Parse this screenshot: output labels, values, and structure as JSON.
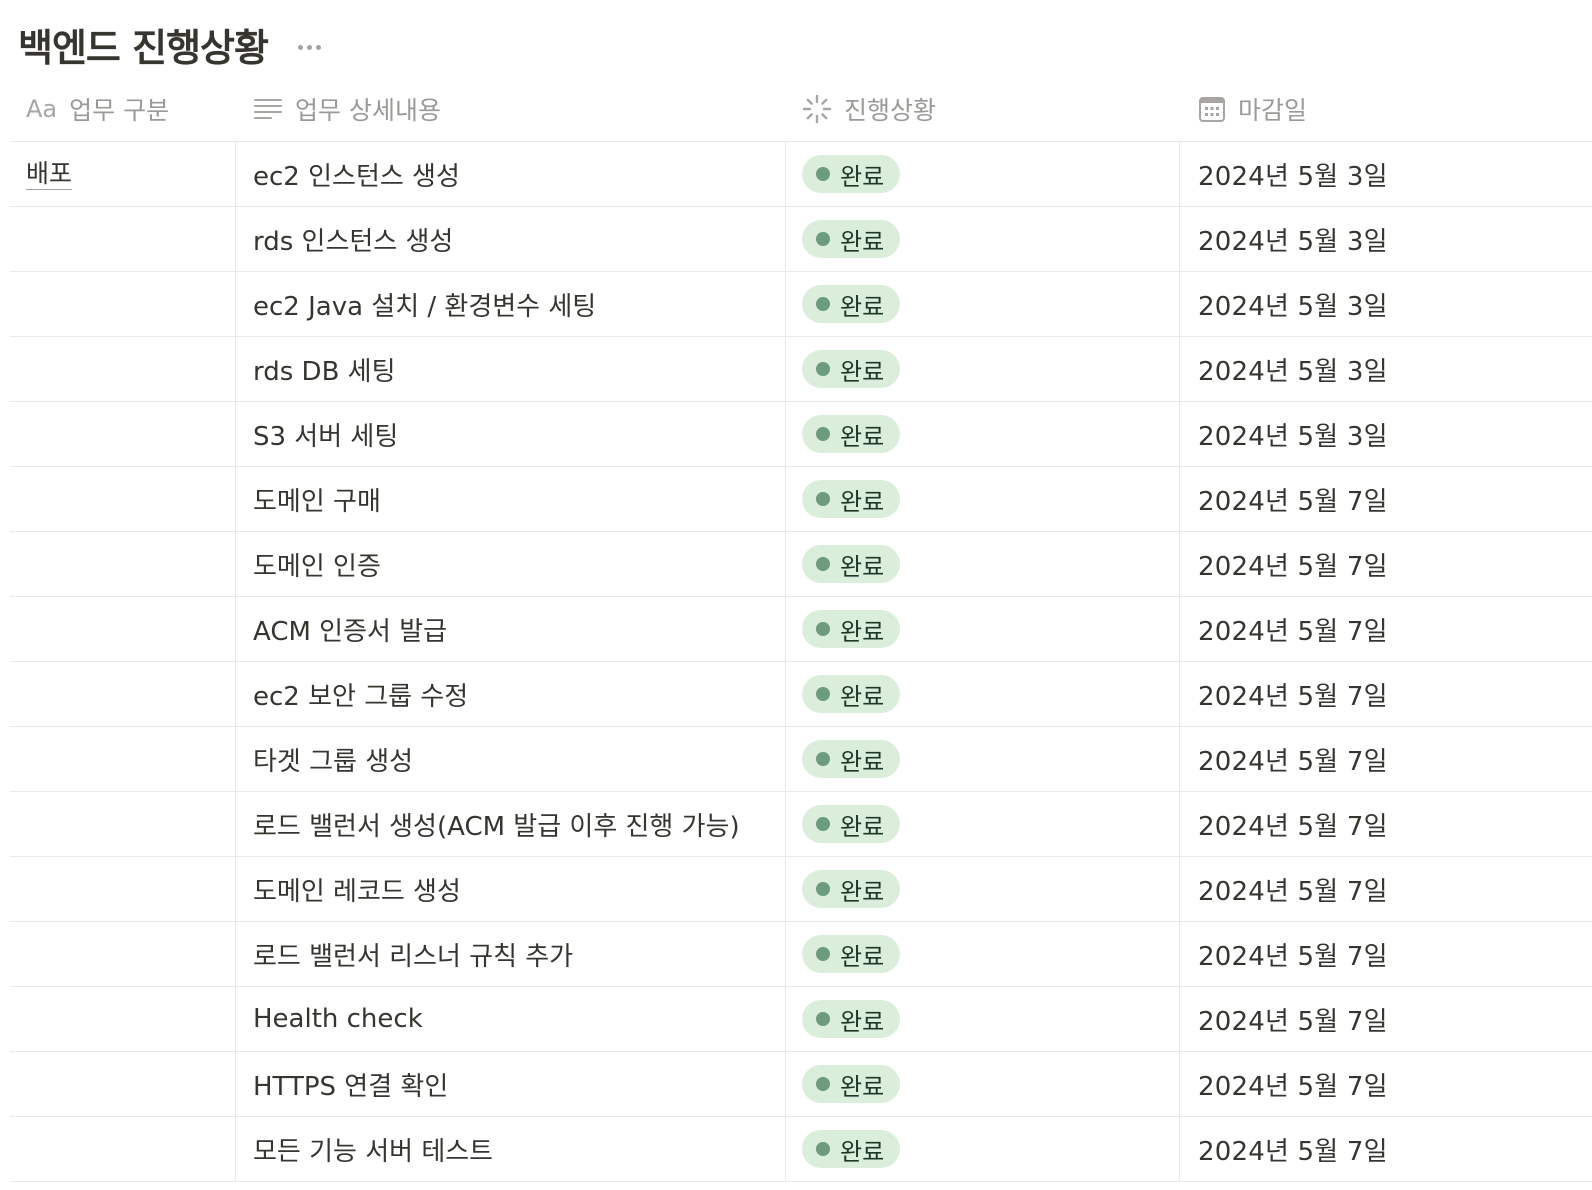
{
  "page": {
    "title": "백엔드 진행상황"
  },
  "columns": [
    {
      "icon": "text-type-icon",
      "icon_text": "Aa",
      "label": "업무 구분"
    },
    {
      "icon": "text-lines-icon",
      "label": "업무 상세내용"
    },
    {
      "icon": "status-spinner-icon",
      "label": "진행상황"
    },
    {
      "icon": "calendar-icon",
      "label": "마감일"
    }
  ],
  "status_colors": {
    "pill_bg": "#dbeddb",
    "dot": "#6c9b7d",
    "text": "#1c3829"
  },
  "rows": [
    {
      "group": "배포",
      "task": "ec2 인스턴스 생성",
      "status": "완료",
      "due": "2024년 5월 3일"
    },
    {
      "group": "",
      "task": "rds 인스턴스 생성",
      "status": "완료",
      "due": "2024년 5월 3일"
    },
    {
      "group": "",
      "task": "ec2 Java 설치 / 환경변수 세팅",
      "status": "완료",
      "due": "2024년 5월 3일"
    },
    {
      "group": "",
      "task": "rds DB 세팅",
      "status": "완료",
      "due": "2024년 5월 3일"
    },
    {
      "group": "",
      "task": "S3 서버 세팅",
      "status": "완료",
      "due": "2024년 5월 3일"
    },
    {
      "group": "",
      "task": "도메인 구매",
      "status": "완료",
      "due": "2024년 5월 7일"
    },
    {
      "group": "",
      "task": "도메인 인증",
      "status": "완료",
      "due": "2024년 5월 7일"
    },
    {
      "group": "",
      "task": "ACM 인증서 발급",
      "status": "완료",
      "due": "2024년 5월 7일"
    },
    {
      "group": "",
      "task": "ec2 보안 그룹 수정",
      "status": "완료",
      "due": "2024년 5월 7일"
    },
    {
      "group": "",
      "task": "타겟 그룹 생성",
      "status": "완료",
      "due": "2024년 5월 7일"
    },
    {
      "group": "",
      "task": "로드 밸런서 생성(ACM 발급 이후 진행 가능)",
      "status": "완료",
      "due": "2024년 5월 7일"
    },
    {
      "group": "",
      "task": "도메인 레코드 생성",
      "status": "완료",
      "due": "2024년 5월 7일"
    },
    {
      "group": "",
      "task": "로드 밸런서 리스너 규칙 추가",
      "status": "완료",
      "due": "2024년 5월 7일"
    },
    {
      "group": "",
      "task": "Health check",
      "status": "완료",
      "due": "2024년 5월 7일"
    },
    {
      "group": "",
      "task": "HTTPS 연결 확인",
      "status": "완료",
      "due": "2024년 5월 7일"
    },
    {
      "group": "",
      "task": "모든 기능 서버 테스트",
      "status": "완료",
      "due": "2024년 5월 7일"
    }
  ]
}
